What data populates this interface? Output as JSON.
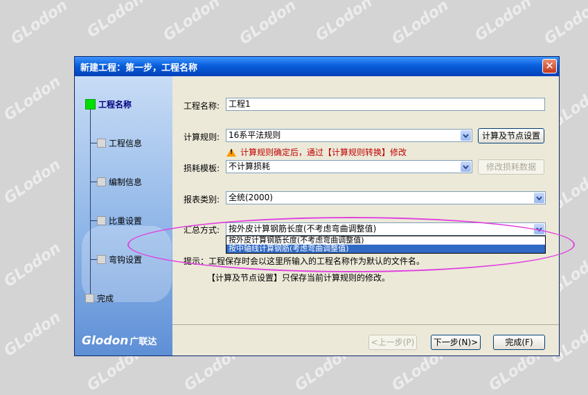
{
  "watermark": {
    "brand": "GLodon",
    "cn": "广联达"
  },
  "dialog": {
    "title": "新建工程：第一步，工程名称",
    "close_label": "✕",
    "steps": [
      {
        "label": "工程名称",
        "state": "active"
      },
      {
        "label": "工程信息",
        "state": "pending"
      },
      {
        "label": "编制信息",
        "state": "pending"
      },
      {
        "label": "比重设置",
        "state": "pending"
      },
      {
        "label": "弯钩设置",
        "state": "pending"
      },
      {
        "label": "完成",
        "state": "pending"
      }
    ],
    "brand": {
      "en": "Glodon",
      "cn": "广联达"
    },
    "form": {
      "project_name_label": "工程名称:",
      "project_name_value": "工程1",
      "rule_label": "计算规则:",
      "rule_value": "16系平法规则",
      "rule_button": "计算及节点设置",
      "rule_warning": "计算规则确定后，通过【计算规则转换】修改",
      "loss_label": "损耗模板:",
      "loss_value": "不计算损耗",
      "loss_button": "修改损耗数据",
      "report_label": "报表类别:",
      "report_value": "全统(2000)",
      "summary_label": "汇总方式:",
      "summary_value": "按外皮计算钢筋长度(不考虑弯曲调整值)",
      "summary_options": [
        {
          "label": "按外皮计算钢筋长度(不考虑弯曲调整值)",
          "selected": false
        },
        {
          "label": "按中轴线计算钢筋(考虑弯曲调整值)",
          "selected": true
        }
      ]
    },
    "hint_line1": "提示：工程保存时会以这里所输入的工程名称作为默认的文件名。",
    "hint_line2": "【计算及节点设置】只保存当前计算规则的修改。",
    "footer": {
      "prev": "<上一步(P)",
      "next": "下一步(N)>",
      "finish": "完成(F)"
    }
  },
  "colors": {
    "highlight_ellipse": "#e040e0",
    "active_step": "#00e000"
  }
}
